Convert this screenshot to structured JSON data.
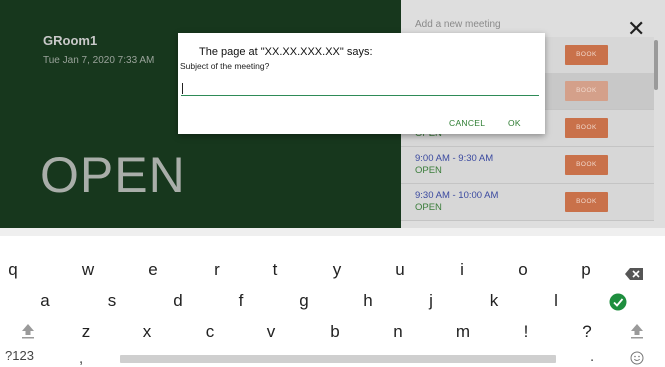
{
  "room": {
    "name": "GRoom1",
    "datetime": "Tue Jan 7, 2020 7:33 AM",
    "status": "OPEN"
  },
  "schedule": {
    "header": "Add a new meeting",
    "close_symbol": "✕",
    "slots": [
      {
        "time": "",
        "status": "",
        "book_label": "BOOK"
      },
      {
        "time": "",
        "status": "",
        "book_label": "BOOK"
      },
      {
        "time": "",
        "status": "OPEN",
        "book_label": "BOOK"
      },
      {
        "time": "9:00 AM - 9:30 AM",
        "status": "OPEN",
        "book_label": "BOOK"
      },
      {
        "time": "9:30 AM - 10:00 AM",
        "status": "OPEN",
        "book_label": "BOOK"
      }
    ],
    "colors": {
      "book_button": "#c9714a",
      "time_text": "#3b4aa0",
      "status_text": "#3b7d3b"
    }
  },
  "dialog": {
    "title": "The page at \"XX.XX.XXX.XX\" says:",
    "message": "Subject of the meeting?",
    "input_value": "",
    "cancel_label": "CANCEL",
    "ok_label": "OK"
  },
  "keyboard": {
    "row1": [
      "q",
      "w",
      "e",
      "r",
      "t",
      "y",
      "u",
      "i",
      "o",
      "p"
    ],
    "row2": [
      "a",
      "s",
      "d",
      "f",
      "g",
      "h",
      "j",
      "k",
      "l"
    ],
    "row3": [
      "z",
      "x",
      "c",
      "v",
      "b",
      "n",
      "m",
      "!",
      "?"
    ],
    "symbols_label": "?123",
    "comma": ",",
    "period": ".",
    "icons": [
      "shift-icon",
      "backspace-icon",
      "enter-icon",
      "emoji-icon"
    ],
    "colors": {
      "enter": "#1e8e3e"
    }
  }
}
